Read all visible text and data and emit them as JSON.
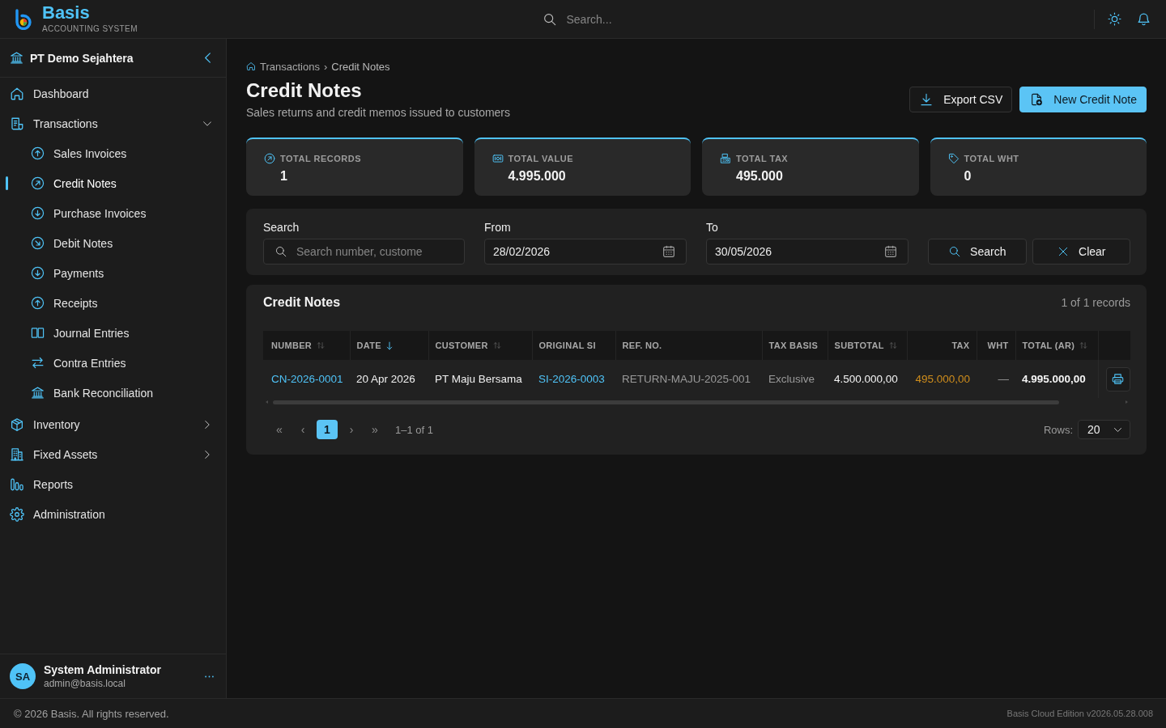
{
  "header": {
    "brand": {
      "name": "Basis",
      "tagline": "ACCOUNTING SYSTEM"
    },
    "search": {
      "placeholder": "Search..."
    }
  },
  "sidebar": {
    "company": "PT Demo Sejahtera",
    "nav": [
      {
        "label": "Dashboard",
        "selected": false
      },
      {
        "label": "Transactions",
        "selected": false,
        "expanded": true,
        "children": [
          {
            "label": "Sales Invoices",
            "selected": false
          },
          {
            "label": "Credit Notes",
            "selected": true
          },
          {
            "label": "Purchase Invoices",
            "selected": false
          },
          {
            "label": "Debit Notes",
            "selected": false
          },
          {
            "label": "Payments",
            "selected": false
          },
          {
            "label": "Receipts",
            "selected": false
          },
          {
            "label": "Journal Entries",
            "selected": false
          },
          {
            "label": "Contra Entries",
            "selected": false
          },
          {
            "label": "Bank Reconciliation",
            "selected": false
          }
        ]
      },
      {
        "label": "Inventory",
        "selected": false,
        "expanded": false
      },
      {
        "label": "Fixed Assets",
        "selected": false,
        "expanded": false
      },
      {
        "label": "Reports",
        "selected": false
      },
      {
        "label": "Administration",
        "selected": false
      }
    ],
    "user": {
      "initials": "SA",
      "name": "System Administrator",
      "email": "admin@basis.local"
    }
  },
  "breadcrumb": {
    "items": [
      "Transactions",
      "Credit Notes"
    ],
    "separator": "›"
  },
  "page": {
    "title": "Credit Notes",
    "subtitle": "Sales returns and credit memos issued to customers",
    "actions": [
      {
        "label": "Export CSV",
        "kind": "secondary"
      },
      {
        "label": "New Credit Note",
        "kind": "primary"
      }
    ]
  },
  "stats": [
    {
      "label": "TOTAL RECORDS",
      "value": "1"
    },
    {
      "label": "TOTAL VALUE",
      "value": "4.995.000"
    },
    {
      "label": "TOTAL TAX",
      "value": "495.000"
    },
    {
      "label": "TOTAL WHT",
      "value": "0"
    }
  ],
  "filters": {
    "search": {
      "label": "Search",
      "placeholder": "Search number, custome"
    },
    "from": {
      "label": "From",
      "value": "28/02/2026"
    },
    "to": {
      "label": "To",
      "value": "30/05/2026"
    },
    "buttons": [
      {
        "label": "Search",
        "kind": "search"
      },
      {
        "label": "Clear",
        "kind": "clear"
      }
    ]
  },
  "table": {
    "title": "Credit Notes",
    "count": "1 of 1 records",
    "columns": [
      {
        "label": "NUMBER",
        "sortable": true,
        "sorted": false
      },
      {
        "label": "DATE",
        "sortable": true,
        "sorted": true
      },
      {
        "label": "CUSTOMER",
        "sortable": true,
        "sorted": false
      },
      {
        "label": "ORIGINAL SI",
        "sortable": false,
        "sorted": false
      },
      {
        "label": "REF. NO.",
        "sortable": false,
        "sorted": false
      },
      {
        "label": "TAX BASIS",
        "sortable": false,
        "sorted": false
      },
      {
        "label": "SUBTOTAL",
        "sortable": true,
        "sorted": false
      },
      {
        "label": "TAX",
        "sortable": false,
        "sorted": false
      },
      {
        "label": "WHT",
        "sortable": false,
        "sorted": false
      },
      {
        "label": "TOTAL (AR)",
        "sortable": true,
        "sorted": false
      }
    ],
    "rows": [
      {
        "cells": [
          {
            "text": "CN-2026-0001",
            "kind": "link"
          },
          {
            "text": "20 Apr 2026",
            "kind": "text"
          },
          {
            "text": "PT Maju Bersama",
            "kind": "text"
          },
          {
            "text": "SI-2026-0003",
            "kind": "link"
          },
          {
            "text": "RETURN-MAJU-2025-001",
            "kind": "muted"
          },
          {
            "text": "Exclusive",
            "kind": "muted"
          },
          {
            "text": "4.500.000,00",
            "kind": "amount"
          },
          {
            "text": "495.000,00",
            "kind": "tax"
          },
          {
            "text": "—",
            "kind": "muted"
          },
          {
            "text": "4.995.000,00",
            "kind": "total"
          }
        ]
      }
    ]
  },
  "pagination": {
    "first": "«",
    "prev": "‹",
    "pages": [
      {
        "label": "1",
        "selected": true
      }
    ],
    "next": "›",
    "last": "»",
    "summary": "1–1 of 1",
    "rows_label": "Rows:",
    "rows_value": "20"
  },
  "footer": {
    "copyright": "© 2026 Basis. All rights reserved.",
    "version": "Basis Cloud Edition v2026.05.28.008"
  }
}
